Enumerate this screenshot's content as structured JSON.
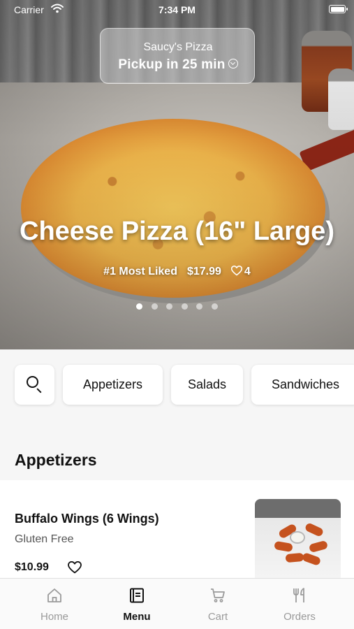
{
  "status_bar": {
    "carrier": "Carrier",
    "time": "7:34 PM"
  },
  "pickup": {
    "restaurant": "Saucy's Pizza",
    "label": "Pickup in 25 min"
  },
  "hero": {
    "title": "Cheese Pizza (16\" Large)",
    "rank": "#1 Most Liked",
    "price": "$17.99",
    "likes": "4",
    "slides_total": 6,
    "slide_active": 1
  },
  "categories": {
    "items": [
      "Appetizers",
      "Salads",
      "Sandwiches"
    ],
    "search_icon": "search-icon"
  },
  "section": {
    "title": "Appetizers"
  },
  "menu_item": {
    "name": "Buffalo Wings (6 Wings)",
    "tag": "Gluten Free",
    "price": "$10.99"
  },
  "tabs": [
    {
      "label": "Home",
      "icon": "home-icon",
      "active": false
    },
    {
      "label": "Menu",
      "icon": "menu-icon",
      "active": true
    },
    {
      "label": "Cart",
      "icon": "cart-icon",
      "active": false
    },
    {
      "label": "Orders",
      "icon": "utensils-icon",
      "active": false
    }
  ],
  "colors": {
    "active_tab": "#111111",
    "inactive_tab": "#9a9a9a",
    "background": "#f6f6f6"
  }
}
